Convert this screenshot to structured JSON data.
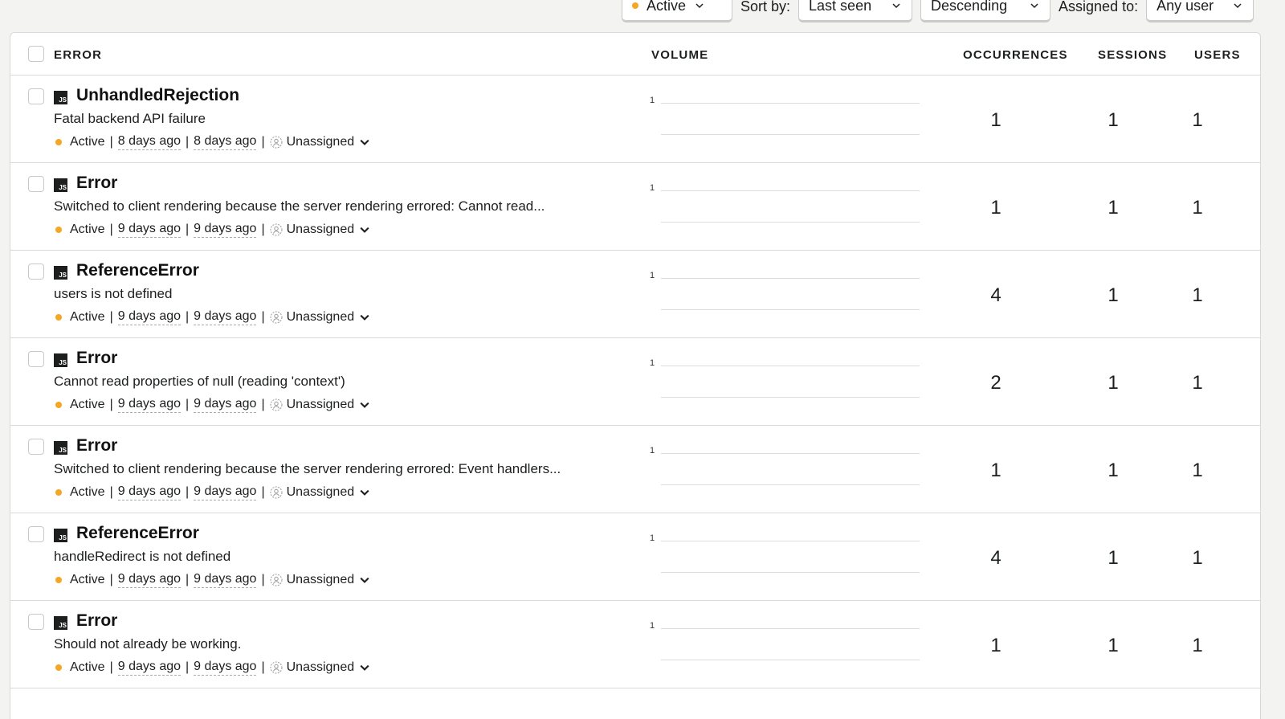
{
  "filters": {
    "status_label": "Active",
    "sort_by_label": "Sort by:",
    "sort_by_value": "Last seen",
    "order_value": "Descending",
    "assigned_label": "Assigned to:",
    "assigned_value": "Any user",
    "status_color": "#f5a623"
  },
  "table": {
    "headers": {
      "error": "ERROR",
      "volume": "VOLUME",
      "occurrences": "OCCURRENCES",
      "sessions": "SESSIONS",
      "users": "USERS"
    },
    "rows": [
      {
        "badge": "JS",
        "title": "UnhandledRejection",
        "message": "Fatal backend API failure",
        "status": "Active",
        "first_seen": "8 days ago",
        "last_seen": "8 days ago",
        "assignee": "Unassigned",
        "volume_max": "1",
        "occurrences": "1",
        "sessions": "1",
        "users": "1"
      },
      {
        "badge": "JS",
        "title": "Error",
        "message": "Switched to client rendering because the server rendering errored: Cannot read...",
        "status": "Active",
        "first_seen": "9 days ago",
        "last_seen": "9 days ago",
        "assignee": "Unassigned",
        "volume_max": "1",
        "occurrences": "1",
        "sessions": "1",
        "users": "1"
      },
      {
        "badge": "JS",
        "title": "ReferenceError",
        "message": "users is not defined",
        "status": "Active",
        "first_seen": "9 days ago",
        "last_seen": "9 days ago",
        "assignee": "Unassigned",
        "volume_max": "1",
        "occurrences": "4",
        "sessions": "1",
        "users": "1"
      },
      {
        "badge": "JS",
        "title": "Error",
        "message": "Cannot read properties of null (reading 'context')",
        "status": "Active",
        "first_seen": "9 days ago",
        "last_seen": "9 days ago",
        "assignee": "Unassigned",
        "volume_max": "1",
        "occurrences": "2",
        "sessions": "1",
        "users": "1"
      },
      {
        "badge": "JS",
        "title": "Error",
        "message": "Switched to client rendering because the server rendering errored: Event handlers...",
        "status": "Active",
        "first_seen": "9 days ago",
        "last_seen": "9 days ago",
        "assignee": "Unassigned",
        "volume_max": "1",
        "occurrences": "1",
        "sessions": "1",
        "users": "1"
      },
      {
        "badge": "JS",
        "title": "ReferenceError",
        "message": "handleRedirect is not defined",
        "status": "Active",
        "first_seen": "9 days ago",
        "last_seen": "9 days ago",
        "assignee": "Unassigned",
        "volume_max": "1",
        "occurrences": "4",
        "sessions": "1",
        "users": "1"
      },
      {
        "badge": "JS",
        "title": "Error",
        "message": "Should not already be working.",
        "status": "Active",
        "first_seen": "9 days ago",
        "last_seen": "9 days ago",
        "assignee": "Unassigned",
        "volume_max": "1",
        "occurrences": "1",
        "sessions": "1",
        "users": "1"
      }
    ]
  }
}
